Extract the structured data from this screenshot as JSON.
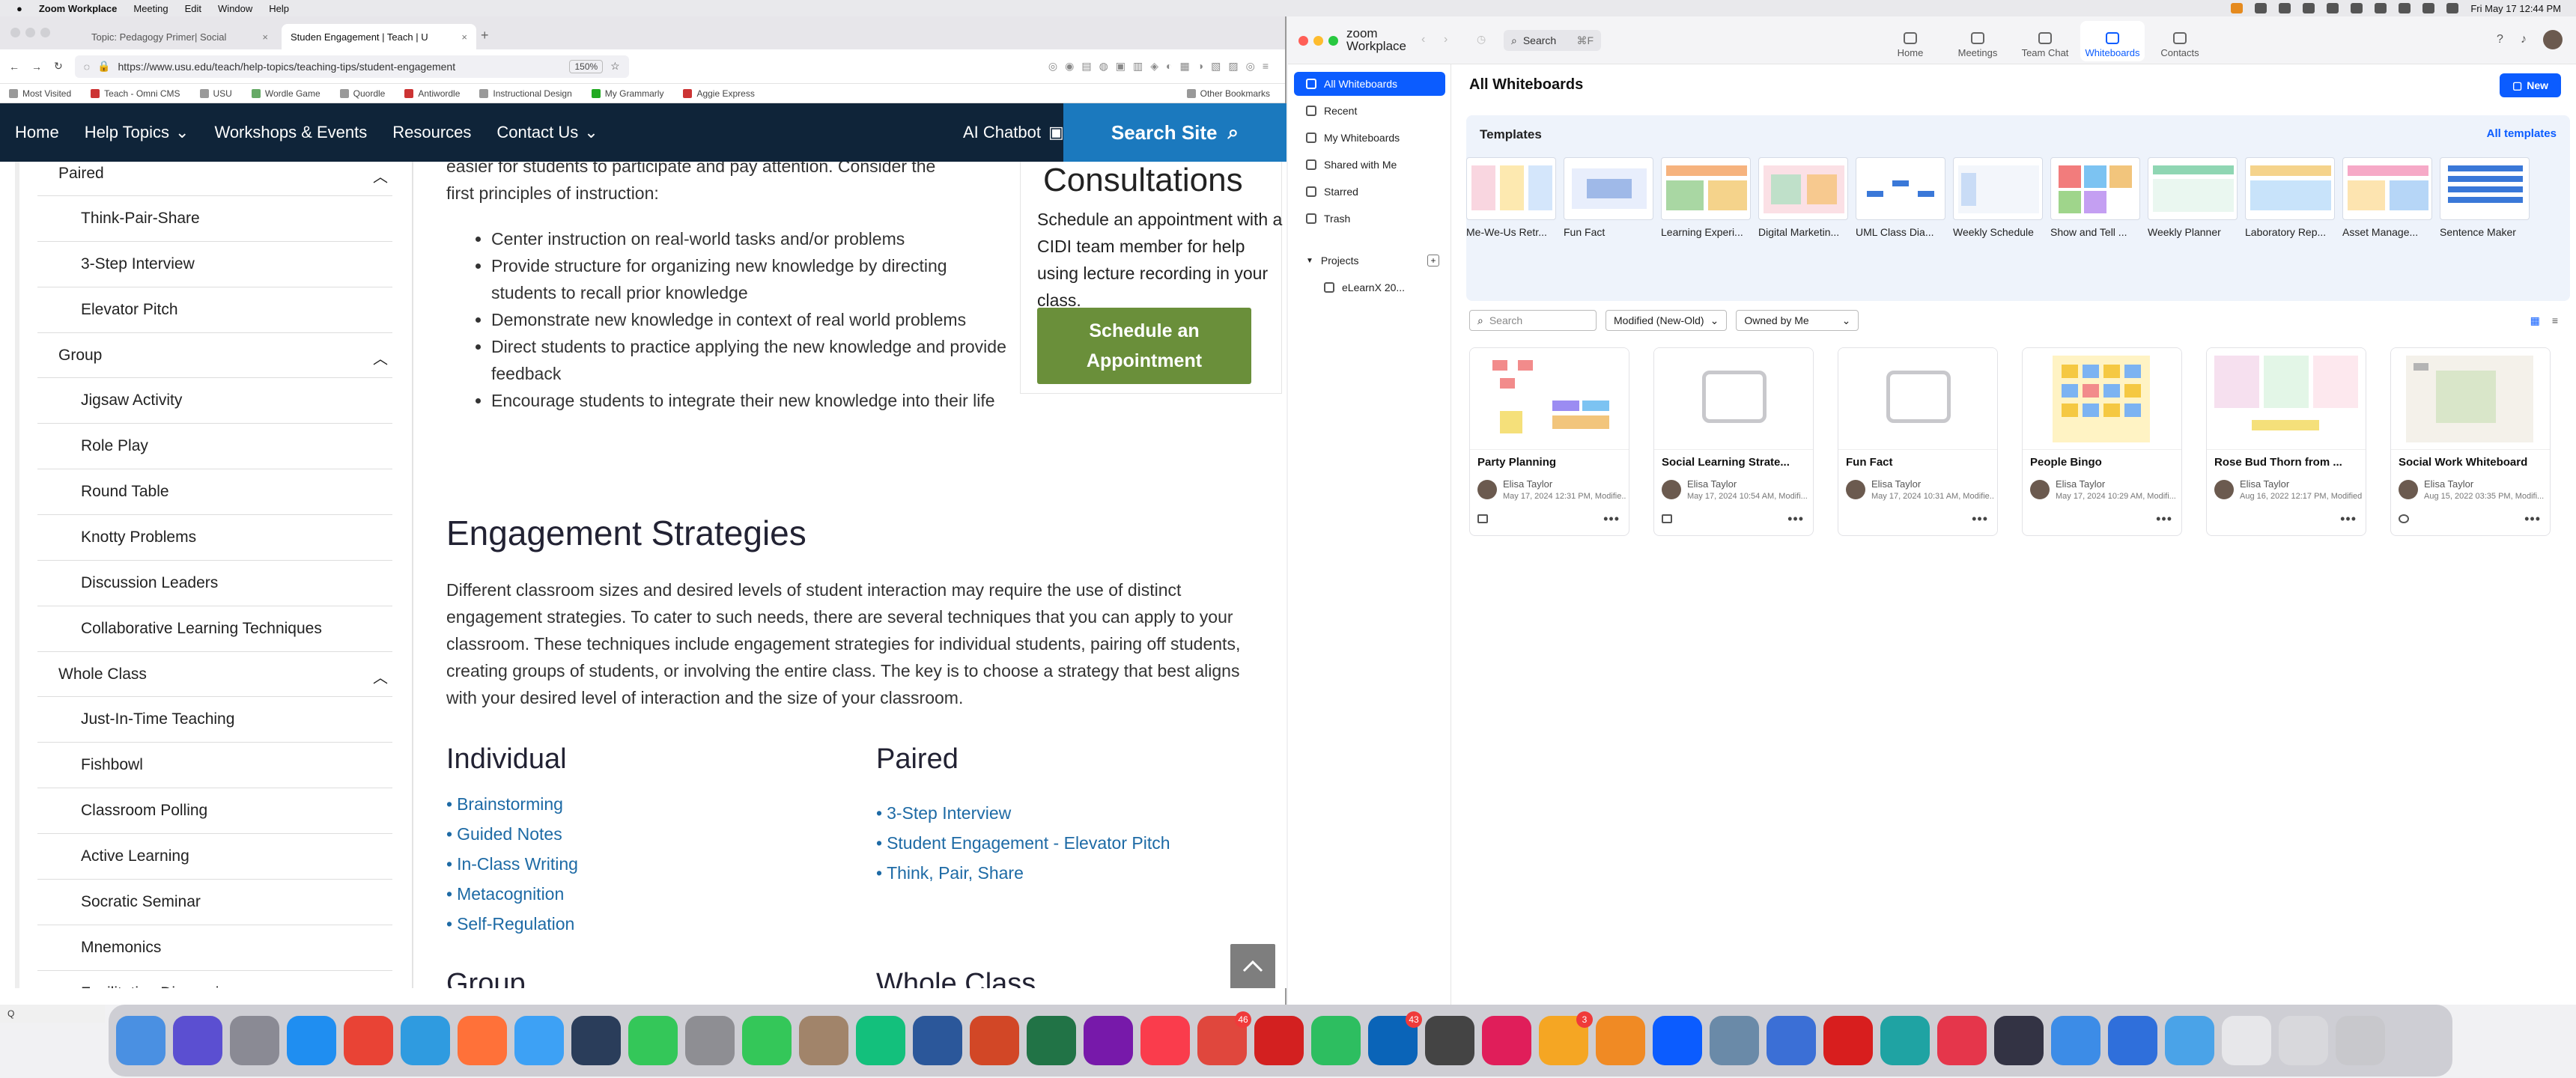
{
  "menubar": {
    "app": "Zoom Workplace",
    "items": [
      "Meeting",
      "Edit",
      "Window",
      "Help"
    ],
    "clock": "Fri May 17  12:44 PM"
  },
  "browser": {
    "tabs": [
      {
        "title": "Topic: Pedagogy Primer| Social"
      },
      {
        "title": "Studen Engagement | Teach | U"
      }
    ],
    "url": "https://www.usu.edu/teach/help-topics/teaching-tips/student-engagement",
    "zoom": "150%",
    "bookmarks": [
      "Most Visited",
      "Teach - Omni CMS",
      "USU",
      "Wordle Game",
      "Quordle",
      "Antiwordle",
      "Instructional Design",
      "My Grammarly",
      "Aggie Express"
    ],
    "other_bookmarks": "Other Bookmarks",
    "status": "Q"
  },
  "site": {
    "nav": {
      "home": "Home",
      "help_topics": "Help Topics",
      "workshops": "Workshops & Events",
      "resources": "Resources",
      "contact": "Contact Us",
      "ai_chatbot": "AI Chatbot",
      "search": "Search Site"
    },
    "sidebar": {
      "groups": [
        {
          "label": "Paired",
          "items": [
            "Think-Pair-Share",
            "3-Step Interview",
            "Elevator Pitch"
          ]
        },
        {
          "label": "Group",
          "items": [
            "Jigsaw Activity",
            "Role Play",
            "Round Table",
            "Knotty Problems",
            "Discussion Leaders",
            "Collaborative Learning Techniques"
          ]
        },
        {
          "label": "Whole Class",
          "items": [
            "Just-In-Time Teaching",
            "Fishbowl",
            "Classroom Polling",
            "Active Learning",
            "Socratic Seminar",
            "Mnemonics",
            "Facilitating Discussions"
          ]
        }
      ]
    },
    "main": {
      "intro": "easier for students to participate and pay attention. Consider the first principles of instruction:",
      "principles": [
        "Center instruction on real-world tasks and/or problems",
        "Provide structure for organizing new knowledge by directing students to recall prior knowledge",
        "Demonstrate new knowledge in context of real world problems",
        "Direct students to practice applying the new knowledge and provide feedback",
        "Encourage students to integrate their new knowledge into their life"
      ],
      "consult_title": "Consultations",
      "consult_text": "Schedule an appointment with a CIDI team member for help using lecture recording in your class.",
      "consult_button": "Schedule an Appointment",
      "strategies_heading": "Engagement Strategies",
      "strategies_text": "Different classroom sizes and desired levels of student interaction may require the use of distinct engagement strategies. To cater to such needs, there are several techniques that you can apply to your classroom. These techniques include engagement strategies for individual students, pairing off students, creating groups of students, or involving the entire class. The key is to choose a strategy that best aligns with your desired level of interaction and the size of your classroom.",
      "individual_heading": "Individual",
      "individual_links": [
        "Brainstorming",
        "Guided Notes",
        "In-Class Writing",
        "Metacognition",
        "Self-Regulation"
      ],
      "paired_heading": "Paired",
      "paired_links": [
        "3-Step Interview",
        "Student Engagement - Elevator Pitch",
        "Think, Pair, Share"
      ],
      "group_heading": "Group",
      "whole_heading": "Whole Class"
    }
  },
  "zoom": {
    "brand_line1": "zoom",
    "brand_line2": "Workplace",
    "search": "Search",
    "search_shortcut": "⌘F",
    "tabs": [
      "Home",
      "Meetings",
      "Team Chat",
      "Whiteboards",
      "Contacts"
    ],
    "active_tab": "Whiteboards",
    "sidebar": {
      "items": [
        "All Whiteboards",
        "Recent",
        "My Whiteboards",
        "Shared with Me",
        "Starred",
        "Trash"
      ],
      "projects_label": "Projects",
      "project_item": "eLearnX 20..."
    },
    "title": "All Whiteboards",
    "new_button": "New",
    "templates_title": "Templates",
    "all_templates": "All templates",
    "templates": [
      "Me-We-Us Retr...",
      "Fun Fact",
      "Learning Experi...",
      "Digital Marketin...",
      "UML Class Dia...",
      "Weekly Schedule",
      "Show and Tell ...",
      "Weekly Planner",
      "Laboratory Rep...",
      "Asset Manage...",
      "Sentence Maker"
    ],
    "search_placeholder": "Search",
    "sort": "Modified (New-Old)",
    "owner": "Owned by Me",
    "cards": [
      {
        "title": "Party Planning",
        "owner": "Elisa Taylor",
        "meta": "May 17, 2024 12:31 PM, Modifie..."
      },
      {
        "title": "Social Learning Strate...",
        "owner": "Elisa Taylor",
        "meta": "May 17, 2024 10:54 AM, Modifi..."
      },
      {
        "title": "Fun Fact",
        "owner": "Elisa Taylor",
        "meta": "May 17, 2024 10:31 AM, Modifie..."
      },
      {
        "title": "People Bingo",
        "owner": "Elisa Taylor",
        "meta": "May 17, 2024 10:29 AM, Modifi..."
      },
      {
        "title": "Rose Bud Thorn from ...",
        "owner": "Elisa Taylor",
        "meta": "Aug 16, 2022 12:17 PM, Modified"
      },
      {
        "title": "Social Work Whiteboard",
        "owner": "Elisa Taylor",
        "meta": "Aug 15, 2022 03:35 PM, Modifi..."
      }
    ]
  },
  "dock": {
    "badges": {
      "things": "46",
      "outlook": "43",
      "teamwork": "3"
    }
  }
}
